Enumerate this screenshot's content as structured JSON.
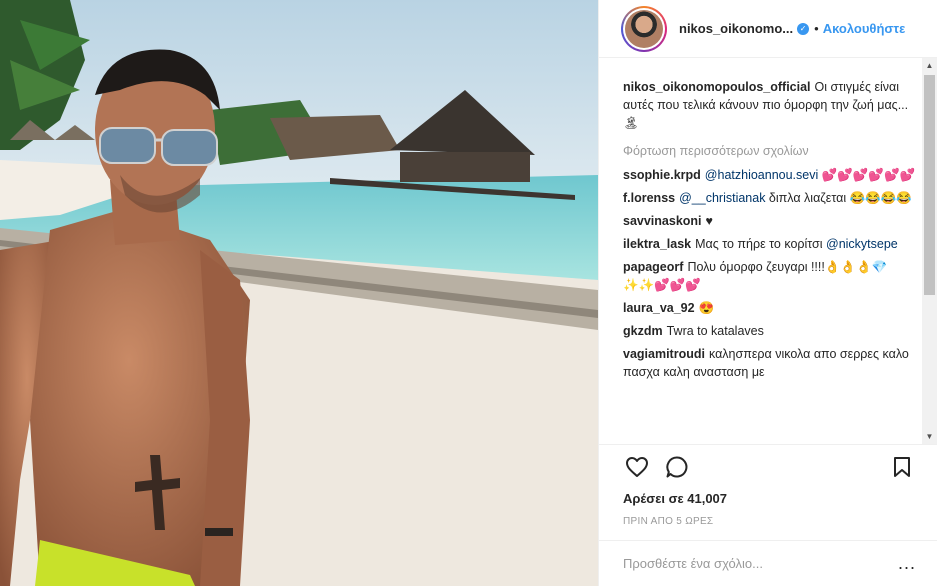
{
  "post": {
    "username": "nikos_oikonomopoulos_official",
    "header_username": "nikos_oikonomo...",
    "follow_label": "Ακολουθήστε",
    "dot": "•",
    "caption": "Οι στιγμές είναι αυτές που τελικά κάνουν πιο όμορφη την ζωή μας... 🏝",
    "load_more_label": "Φόρτωση περισσότερων σχολίων",
    "likes_label": "Αρέσει σε 41,007",
    "time_label": "ΠΡΙΝ ΑΠΟ 5 ΩΡΕΣ",
    "add_comment_placeholder": "Προσθέστε ένα σχόλιο...",
    "more_options": "..."
  },
  "comments": [
    {
      "user": "ssophie.krpd",
      "mention": "@hatzhioannou.sevi",
      "text": " 💕💕💕💕💕💕"
    },
    {
      "user": "f.lorenss",
      "mention": "@__christianak",
      "text": " διπλα λιαζεται 😂😂😂😂"
    },
    {
      "user": "savvinaskoni",
      "mention": "",
      "text": "♥"
    },
    {
      "user": "ilektra_lask",
      "mention": "",
      "text": "Μας το πήρε το κορίτσι ",
      "mention_after": "@nickytsepe"
    },
    {
      "user": "papageorf",
      "mention": "",
      "text": "Πολυ όμορφο ζευγαρι !!!!👌👌👌💎✨✨💕💕💕"
    },
    {
      "user": "laura_va_92",
      "mention": "",
      "text": "😍"
    },
    {
      "user": "gkzdm",
      "mention": "",
      "text": "Twra to katalaves"
    },
    {
      "user": "vagiamitroudi",
      "mention": "",
      "text": "καλησπερα νικολα απο σερρες καλο πασχα καλη ανασταση με"
    }
  ],
  "icons": {
    "like": "heart-icon",
    "comment": "comment-bubble-icon",
    "save": "bookmark-icon",
    "verified": "verified-badge-icon"
  },
  "colors": {
    "accent": "#3897f0",
    "mention": "#003569",
    "muted": "#999999",
    "text": "#262626"
  }
}
